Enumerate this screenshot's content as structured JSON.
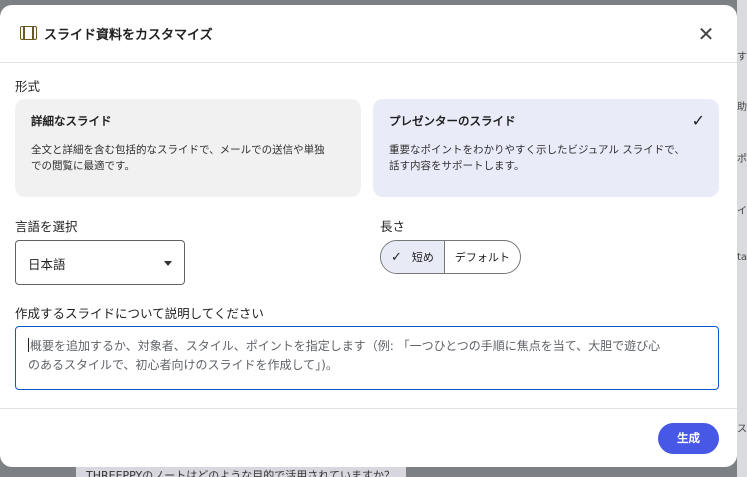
{
  "dialog": {
    "title": "スライド資料をカスタマイズ",
    "close_label": "✕"
  },
  "format": {
    "label": "形式",
    "options": [
      {
        "title": "詳細なスライド",
        "description_line1": "全文と詳細を含む包括的なスライドで、メールでの送信や単独",
        "description_line2": "での閲覧に最適です。",
        "selected": false
      },
      {
        "title": "プレゼンターのスライド",
        "description_line1": "重要なポイントをわかりやすく示したビジュアル スライドで、",
        "description_line2": "話す内容をサポートします。",
        "selected": true,
        "check": "✓"
      }
    ]
  },
  "language": {
    "label": "言語を選択",
    "selected": "日本語"
  },
  "length": {
    "label": "長さ",
    "options": [
      {
        "label": "短め",
        "selected": true,
        "check": "✓"
      },
      {
        "label": "デフォルト",
        "selected": false
      }
    ]
  },
  "describe": {
    "label": "作成するスライドについて説明してください",
    "placeholder_line1": "概要を追加するか、対象者、スタイル、ポイントを指定します（例: 「一つひとつの手順に焦点を当て、大胆で遊び心",
    "placeholder_line2": "のあるスタイルで、初心者向けのスライドを作成して」)。"
  },
  "footer": {
    "generate_label": "生成"
  },
  "background": {
    "bottom_chip_text": "THREEPPYのノートはどのような目的で活用されていますか？",
    "right_strip": [
      "す",
      "助",
      "ポー",
      "イン",
      "ta",
      "ス"
    ]
  },
  "colors": {
    "accent": "#4758e6",
    "selected_card": "#e9ecf8",
    "focus_border": "#0b57d0"
  }
}
